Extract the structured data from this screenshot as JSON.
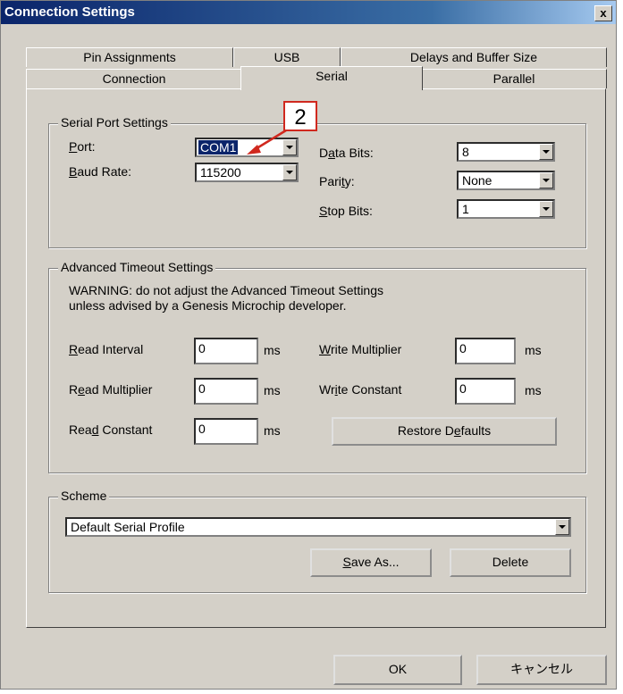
{
  "window": {
    "title": "Connection Settings",
    "close_label": "x"
  },
  "tabs_back": [
    "Pin Assignments",
    "USB",
    "Delays and Buffer Size"
  ],
  "tabs_front": [
    "Connection",
    "Serial",
    "Parallel"
  ],
  "serial": {
    "group_label": "Serial Port Settings",
    "port_label_u": "P",
    "port_label_rest": "ort:",
    "port_value": "COM1",
    "baud_label_u": "B",
    "baud_label_rest": "aud Rate:",
    "baud_value": "115200",
    "databits_label_pre": "D",
    "databits_label_u": "a",
    "databits_label_rest": "ta Bits:",
    "databits_value": "8",
    "parity_label_pre": "Pari",
    "parity_label_u": "t",
    "parity_label_rest": "y:",
    "parity_value": "None",
    "stopbits_label_u": "S",
    "stopbits_label_rest": "top Bits:",
    "stopbits_value": "1"
  },
  "timeout": {
    "group_label": "Advanced Timeout Settings",
    "warning_line1": "WARNING: do not adjust the Advanced Timeout Settings",
    "warning_line2": "unless advised by a Genesis Microchip developer.",
    "read_interval_u": "R",
    "read_interval_rest": "ead Interval",
    "read_interval_value": "0",
    "read_mult_pre": "R",
    "read_mult_u": "e",
    "read_mult_rest": "ad Multiplier",
    "read_mult_value": "0",
    "read_const_pre": "Rea",
    "read_const_u": "d",
    "read_const_rest": " Constant",
    "read_const_value": "0",
    "write_mult_u": "W",
    "write_mult_rest": "rite Multiplier",
    "write_mult_value": "0",
    "write_const_pre": "Wr",
    "write_const_u": "i",
    "write_const_rest": "te Constant",
    "write_const_value": "0",
    "unit": "ms",
    "restore_pre": "Restore D",
    "restore_u": "e",
    "restore_rest": "faults"
  },
  "scheme": {
    "group_label": "Scheme",
    "value": "Default Serial Profile",
    "save_u": "S",
    "save_rest": "ave As...",
    "delete_label": "Delete"
  },
  "footer": {
    "ok_label": "OK",
    "cancel_label": "キャンセル"
  },
  "callout": {
    "number": "2",
    "color": "#d0281e"
  }
}
